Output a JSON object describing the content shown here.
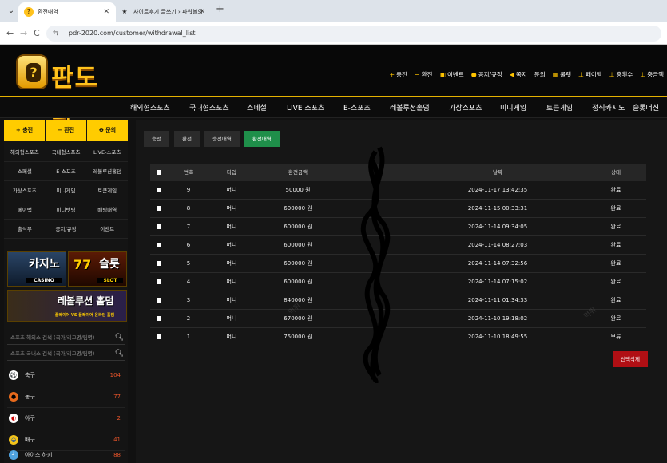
{
  "browser": {
    "tabs": [
      {
        "title": "환전내역",
        "active": true
      },
      {
        "title": "사이트후기 글쓰기 › 파워볼의",
        "active": false
      }
    ],
    "url": "pdr-2020.com/customer/withdrawal_list"
  },
  "site": {
    "logo_text": "판도라",
    "top_menu": [
      {
        "label": "충전",
        "icon": "plus-icon"
      },
      {
        "label": "환전",
        "icon": "minus-icon"
      },
      {
        "label": "이벤트",
        "icon": "gift-icon"
      },
      {
        "label": "공지/규정",
        "icon": "info-icon"
      },
      {
        "label": "쪽지",
        "icon": "mail-icon"
      },
      {
        "label": "문의",
        "icon": "question-icon"
      },
      {
        "label": "룰렛",
        "icon": "roulette-icon"
      },
      {
        "label": "페이백",
        "icon": "payback-icon"
      },
      {
        "label": "충횟수",
        "icon": "count-icon"
      },
      {
        "label": "충금액",
        "icon": "amount-icon"
      }
    ],
    "gnb": [
      "해외형스포츠",
      "국내형스포츠",
      "스페셜",
      "LIVE 스포츠",
      "E-스포츠",
      "레볼루션홀덤",
      "가상스포츠",
      "미니게임",
      "토큰게임",
      "정식카지노",
      "슬롯머신"
    ]
  },
  "sidebar": {
    "quick": [
      {
        "label": "+ 충전"
      },
      {
        "label": "− 환전"
      },
      {
        "label": "❶ 문의"
      }
    ],
    "grid": [
      [
        "해외형스포츠",
        "국내형스포츠",
        "LIVE-스포츠"
      ],
      [
        "스페셜",
        "E-스포츠",
        "레볼루션홀덤"
      ],
      [
        "가상스포츠",
        "미니게임",
        "토큰게임"
      ],
      [
        "페이백",
        "미니뱃팅",
        "배팅내역"
      ],
      [
        "출석부",
        "공지/규정",
        "이벤트"
      ]
    ],
    "banners": {
      "casino": {
        "title": "카지노",
        "sub": "CASINO"
      },
      "slot": {
        "title": "슬롯",
        "sub": "SLOT"
      },
      "holdem": {
        "title": "레볼루션 홀덤",
        "sub": "플레이어 VS 플레이어 온라인 홀덤"
      }
    },
    "search": [
      {
        "placeholder": "스포츠 해외스 검색 (국가/리그명/팀명)"
      },
      {
        "placeholder": "스포츠 국내스 검색 (국가/리그명/팀명)"
      }
    ],
    "sports": [
      {
        "name": "축구",
        "count": "104",
        "icon": "soccer-icon",
        "color": "#ffffff"
      },
      {
        "name": "농구",
        "count": "77",
        "icon": "basketball-icon",
        "color": "#e86a1c"
      },
      {
        "name": "야구",
        "count": "2",
        "icon": "baseball-icon",
        "color": "#ffffff"
      },
      {
        "name": "배구",
        "count": "41",
        "icon": "volleyball-icon",
        "color": "#f3c31a"
      },
      {
        "name": "아이스 하키",
        "count": "88",
        "icon": "hockey-icon",
        "color": "#4fa3e0"
      }
    ]
  },
  "main": {
    "tabs": [
      {
        "label": "충전",
        "active": false
      },
      {
        "label": "환전",
        "active": false
      },
      {
        "label": "충전내역",
        "active": false
      },
      {
        "label": "환전내역",
        "active": true
      }
    ],
    "table": {
      "headers": [
        "번호",
        "타입",
        "환전금액",
        "",
        "날짜",
        "상태"
      ],
      "rows": [
        {
          "no": "9",
          "type": "머니",
          "amount": "50000 원",
          "date": "2024-11-17 13:42:35",
          "status": "완료"
        },
        {
          "no": "8",
          "type": "머니",
          "amount": "600000 원",
          "date": "2024-11-15 00:33:31",
          "status": "완료"
        },
        {
          "no": "7",
          "type": "머니",
          "amount": "600000 원",
          "date": "2024-11-14 09:34:05",
          "status": "완료"
        },
        {
          "no": "6",
          "type": "머니",
          "amount": "600000 원",
          "date": "2024-11-14 08:27:03",
          "status": "완료"
        },
        {
          "no": "5",
          "type": "머니",
          "amount": "600000 원",
          "date": "2024-11-14 07:32:56",
          "status": "완료"
        },
        {
          "no": "4",
          "type": "머니",
          "amount": "600000 원",
          "date": "2024-11-14 07:15:02",
          "status": "완료"
        },
        {
          "no": "3",
          "type": "머니",
          "amount": "840000 원",
          "date": "2024-11-11 01:34:33",
          "status": "완료"
        },
        {
          "no": "2",
          "type": "머니",
          "amount": "670000 원",
          "date": "2024-11-10 19:18:02",
          "status": "완료"
        },
        {
          "no": "1",
          "type": "머니",
          "amount": "750000 원",
          "date": "2024-11-10 18:49:55",
          "status": "보류"
        }
      ]
    },
    "delete_label": "선택삭제"
  },
  "colors": {
    "accent": "#ffcc00",
    "active_tab": "#1f8f4a",
    "danger": "#b00f14"
  }
}
